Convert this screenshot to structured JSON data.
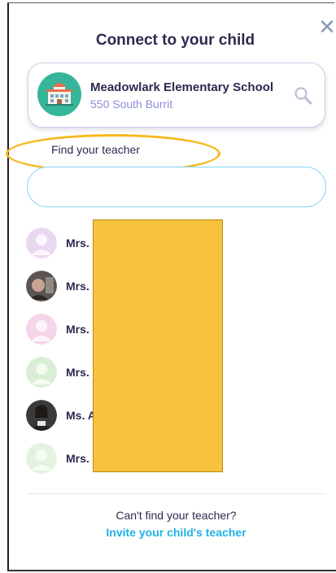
{
  "modal": {
    "title": "Connect to your child",
    "close_icon": "close-icon"
  },
  "school": {
    "name": "Meadowlark Elementary School",
    "address": "550 South Burrit",
    "avatar_icon": "school-building-icon",
    "search_icon": "search-icon",
    "avatar_color": "#36b59a"
  },
  "find_teacher": {
    "label": "Find your teacher",
    "input_value": "",
    "placeholder": ""
  },
  "teachers": [
    {
      "name": "Mrs.",
      "avatar": "default-avatar-purple"
    },
    {
      "name": "Mrs.",
      "avatar": "photo-avatar"
    },
    {
      "name": "Mrs.",
      "avatar": "default-avatar-pink"
    },
    {
      "name": "Mrs.",
      "avatar": "default-avatar-green"
    },
    {
      "name": "Ms. A",
      "avatar": "photo-avatar"
    },
    {
      "name": "Mrs.",
      "avatar": "default-avatar-green"
    }
  ],
  "footer": {
    "cant_find": "Can't find your teacher?",
    "invite_link": "Invite your child's teacher"
  },
  "colors": {
    "title": "#2c2a50",
    "link": "#21b1e3",
    "accent_teal": "#36b59a",
    "annotation_yellow": "#f5b81f",
    "redaction": "#f8c33c"
  }
}
